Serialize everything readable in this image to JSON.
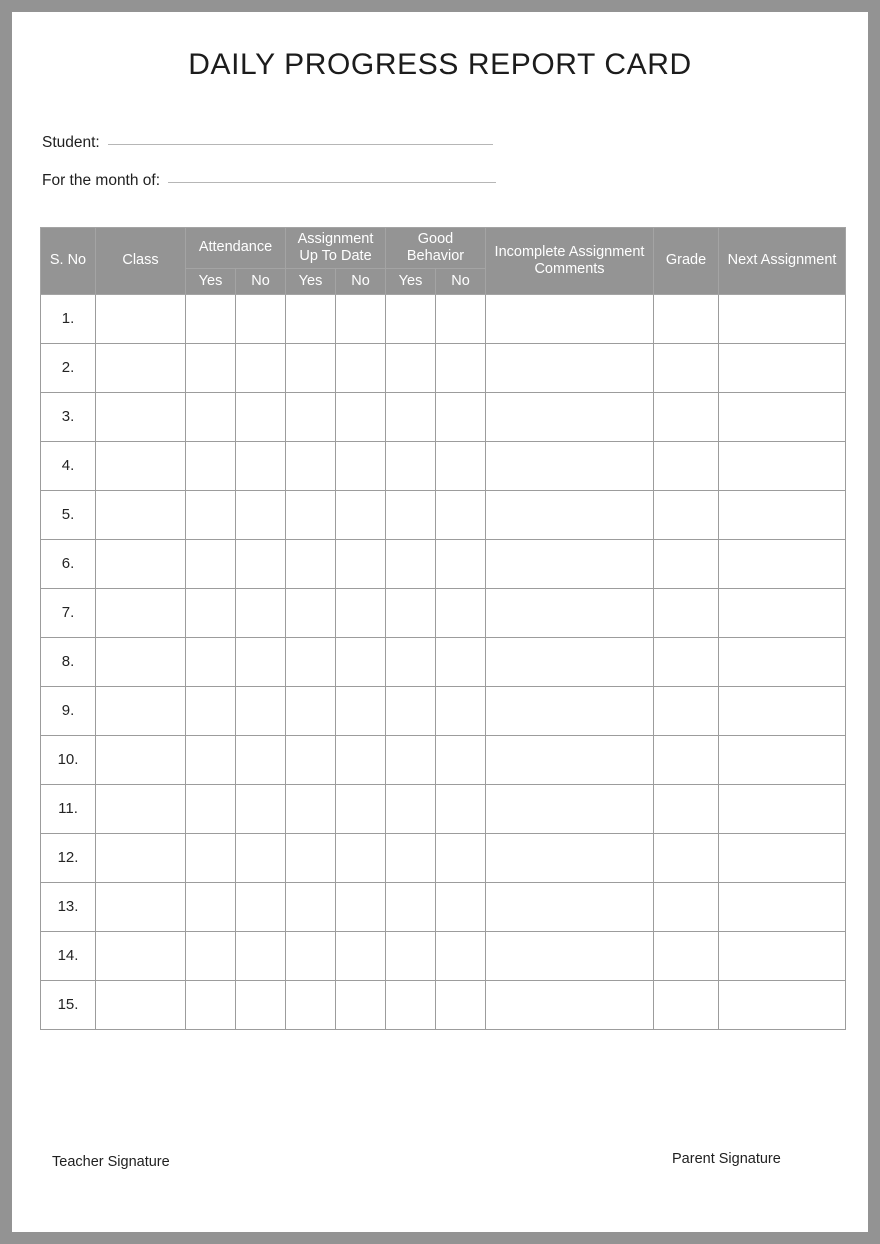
{
  "document": {
    "title": "DAILY PROGRESS REPORT CARD"
  },
  "form": {
    "student": {
      "label": "Student:",
      "value": "",
      "placeholder": ""
    },
    "month": {
      "label": "For the month of:",
      "value": "",
      "placeholder": ""
    }
  },
  "table": {
    "headers": {
      "sno": "S. No",
      "class": "Class",
      "attendance": "Attendance",
      "assignment_up_to_date": "Assignment Up To Date",
      "good_behavior": "Good Behavior",
      "incomplete_assignment_comments": "Incomplete Assignment Comments",
      "grade": "Grade",
      "next_assignment": "Next Assignment",
      "yes": "Yes",
      "no": "No"
    },
    "rows": [
      {
        "sno": "1.",
        "class": "",
        "attendance_yes": "",
        "attendance_no": "",
        "assignment_yes": "",
        "assignment_no": "",
        "behavior_yes": "",
        "behavior_no": "",
        "comments": "",
        "grade": "",
        "next_assignment": ""
      },
      {
        "sno": "2.",
        "class": "",
        "attendance_yes": "",
        "attendance_no": "",
        "assignment_yes": "",
        "assignment_no": "",
        "behavior_yes": "",
        "behavior_no": "",
        "comments": "",
        "grade": "",
        "next_assignment": ""
      },
      {
        "sno": "3.",
        "class": "",
        "attendance_yes": "",
        "attendance_no": "",
        "assignment_yes": "",
        "assignment_no": "",
        "behavior_yes": "",
        "behavior_no": "",
        "comments": "",
        "grade": "",
        "next_assignment": ""
      },
      {
        "sno": "4.",
        "class": "",
        "attendance_yes": "",
        "attendance_no": "",
        "assignment_yes": "",
        "assignment_no": "",
        "behavior_yes": "",
        "behavior_no": "",
        "comments": "",
        "grade": "",
        "next_assignment": ""
      },
      {
        "sno": "5.",
        "class": "",
        "attendance_yes": "",
        "attendance_no": "",
        "assignment_yes": "",
        "assignment_no": "",
        "behavior_yes": "",
        "behavior_no": "",
        "comments": "",
        "grade": "",
        "next_assignment": ""
      },
      {
        "sno": "6.",
        "class": "",
        "attendance_yes": "",
        "attendance_no": "",
        "assignment_yes": "",
        "assignment_no": "",
        "behavior_yes": "",
        "behavior_no": "",
        "comments": "",
        "grade": "",
        "next_assignment": ""
      },
      {
        "sno": "7.",
        "class": "",
        "attendance_yes": "",
        "attendance_no": "",
        "assignment_yes": "",
        "assignment_no": "",
        "behavior_yes": "",
        "behavior_no": "",
        "comments": "",
        "grade": "",
        "next_assignment": ""
      },
      {
        "sno": "8.",
        "class": "",
        "attendance_yes": "",
        "attendance_no": "",
        "assignment_yes": "",
        "assignment_no": "",
        "behavior_yes": "",
        "behavior_no": "",
        "comments": "",
        "grade": "",
        "next_assignment": ""
      },
      {
        "sno": "9.",
        "class": "",
        "attendance_yes": "",
        "attendance_no": "",
        "assignment_yes": "",
        "assignment_no": "",
        "behavior_yes": "",
        "behavior_no": "",
        "comments": "",
        "grade": "",
        "next_assignment": ""
      },
      {
        "sno": "10.",
        "class": "",
        "attendance_yes": "",
        "attendance_no": "",
        "assignment_yes": "",
        "assignment_no": "",
        "behavior_yes": "",
        "behavior_no": "",
        "comments": "",
        "grade": "",
        "next_assignment": ""
      },
      {
        "sno": "11.",
        "class": "",
        "attendance_yes": "",
        "attendance_no": "",
        "assignment_yes": "",
        "assignment_no": "",
        "behavior_yes": "",
        "behavior_no": "",
        "comments": "",
        "grade": "",
        "next_assignment": ""
      },
      {
        "sno": "12.",
        "class": "",
        "attendance_yes": "",
        "attendance_no": "",
        "assignment_yes": "",
        "assignment_no": "",
        "behavior_yes": "",
        "behavior_no": "",
        "comments": "",
        "grade": "",
        "next_assignment": ""
      },
      {
        "sno": "13.",
        "class": "",
        "attendance_yes": "",
        "attendance_no": "",
        "assignment_yes": "",
        "assignment_no": "",
        "behavior_yes": "",
        "behavior_no": "",
        "comments": "",
        "grade": "",
        "next_assignment": ""
      },
      {
        "sno": "14.",
        "class": "",
        "attendance_yes": "",
        "attendance_no": "",
        "assignment_yes": "",
        "assignment_no": "",
        "behavior_yes": "",
        "behavior_no": "",
        "comments": "",
        "grade": "",
        "next_assignment": ""
      },
      {
        "sno": "15.",
        "class": "",
        "attendance_yes": "",
        "attendance_no": "",
        "assignment_yes": "",
        "assignment_no": "",
        "behavior_yes": "",
        "behavior_no": "",
        "comments": "",
        "grade": "",
        "next_assignment": ""
      }
    ]
  },
  "footer": {
    "teacher_signature": "Teacher Signature",
    "parent_signature": "Parent Signature"
  },
  "colors": {
    "header_fill": "#949494",
    "header_text": "#ffffff",
    "page_background": "#ffffff",
    "frame": "#939393",
    "grid_line": "#9c9c9c",
    "rule_line": "#b6b6b6",
    "body_text": "#1f1f1f"
  }
}
